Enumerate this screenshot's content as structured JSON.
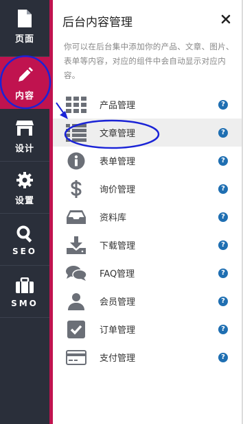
{
  "sidebar": {
    "items": [
      {
        "label": "页面",
        "icon": "page-icon",
        "active": false
      },
      {
        "label": "内容",
        "icon": "pencil-icon",
        "active": true
      },
      {
        "label": "设计",
        "icon": "store-icon",
        "active": false
      },
      {
        "label": "设置",
        "icon": "gear-icon",
        "active": false
      },
      {
        "label": "SEO",
        "icon": "search-icon",
        "active": false
      },
      {
        "label": "SMO",
        "icon": "briefcase-icon",
        "active": false
      }
    ]
  },
  "panel": {
    "title": "后台内容管理",
    "close": "×",
    "description": "你可以在后台集中添加你的产品、文章、图片、表单等内容，对应的组件中会自动显示对应内容。"
  },
  "menu": {
    "help_glyph": "?",
    "items": [
      {
        "label": "产品管理",
        "icon": "grid-icon"
      },
      {
        "label": "文章管理",
        "icon": "list-icon"
      },
      {
        "label": "表单管理",
        "icon": "info-icon"
      },
      {
        "label": "询价管理",
        "icon": "dollar-icon"
      },
      {
        "label": "资料库",
        "icon": "inbox-icon"
      },
      {
        "label": "下载管理",
        "icon": "download-icon"
      },
      {
        "label": "FAQ管理",
        "icon": "chat-icon"
      },
      {
        "label": "会员管理",
        "icon": "user-icon"
      },
      {
        "label": "订单管理",
        "icon": "checkbox-icon"
      },
      {
        "label": "支付管理",
        "icon": "credit-card-icon"
      }
    ]
  },
  "colors": {
    "sidebar_bg": "#2a2f3a",
    "accent": "#c0134f",
    "help": "#1f6fb2",
    "annotation": "#1a23d6",
    "icon": "#6b6f77"
  }
}
